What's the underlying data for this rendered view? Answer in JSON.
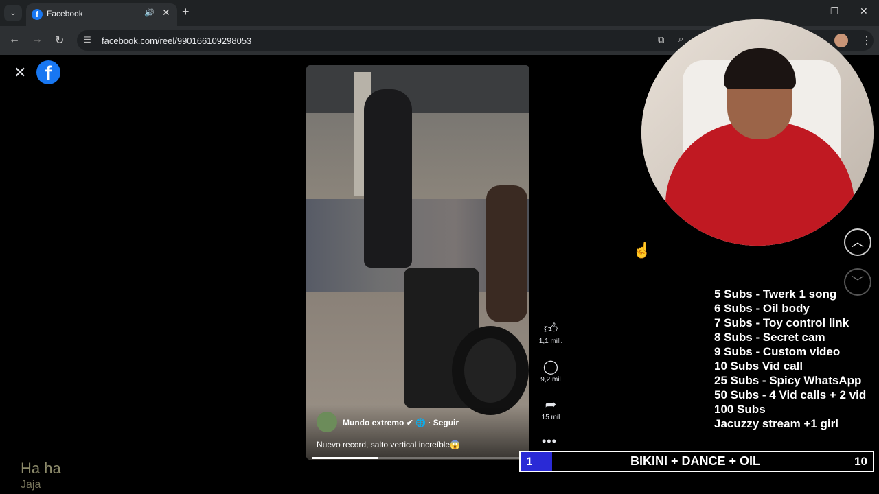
{
  "browser": {
    "tab_title": "Facebook",
    "url": "facebook.com/reel/990166109298053",
    "icons": [
      "chevron-down-icon",
      "facebook-favicon",
      "speaker-icon",
      "close-icon",
      "plus-icon",
      "minimize-icon",
      "restore-icon",
      "close-icon",
      "back-icon",
      "forward-icon",
      "reload-icon",
      "site-info-icon",
      "install-icon",
      "zoom-icon",
      "profile-avatar",
      "kebab-icon"
    ]
  },
  "reel": {
    "author": "Mundo extremo",
    "follow_label": "Seguir",
    "caption": "Nuevo record, salto vertical increíble😱",
    "progress": 0.31,
    "actions": {
      "likes": "1,1 mill.",
      "comments": "9,2 mil",
      "shares": "15 mil"
    }
  },
  "overlay": {
    "comment_main": "Ha ha",
    "comment_sub": "Jaja",
    "subs_menu": [
      "5 Subs - Twerk 1 song",
      "6 Subs - Oil body",
      "7 Subs - Toy control link",
      "8 Subs - Secret cam",
      "9 Subs - Custom video",
      "10 Subs Vid call",
      "25 Subs - Spicy WhatsApp",
      "50 Subs - 4 Vid calls + 2 vid",
      "100 Subs",
      "Jacuzzy stream +1 girl"
    ],
    "goal_current": "1",
    "goal_text": "BIKINI + DANCE + OIL",
    "goal_target": "10"
  },
  "colors": {
    "facebook_blue": "#1877f2",
    "goal_bar": "#2a2ad6",
    "chrome_dark": "#1f2224"
  }
}
